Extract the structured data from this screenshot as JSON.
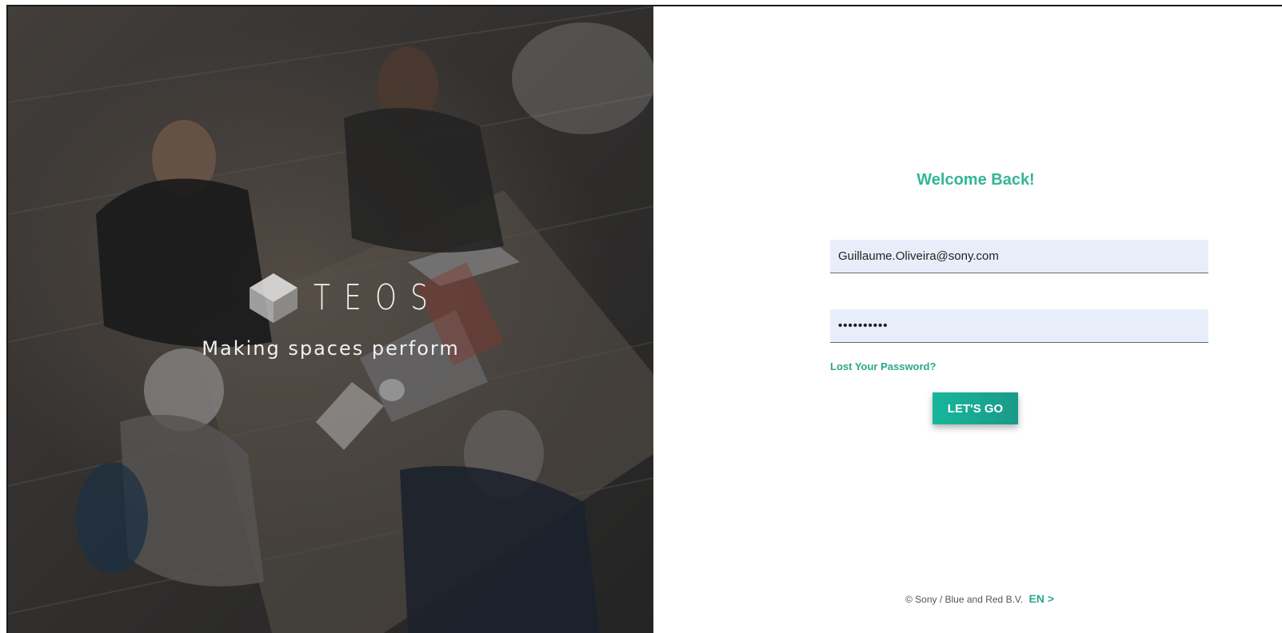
{
  "brand": {
    "logo_text": "TEOS",
    "tagline": "Making spaces perform"
  },
  "login": {
    "heading": "Welcome Back!",
    "email_value": "Guillaume.Oliveira@sony.com",
    "password_value": "••••••••••",
    "lost_password_label": "Lost Your Password?",
    "submit_label": "LET'S GO"
  },
  "footer": {
    "copyright": "© Sony / Blue and Red B.V.",
    "language_label": "EN >"
  },
  "colors": {
    "accent": "#33b596",
    "button_start": "#18b69b",
    "button_end": "#1a9a8a",
    "field_bg": "#e8eef9"
  }
}
